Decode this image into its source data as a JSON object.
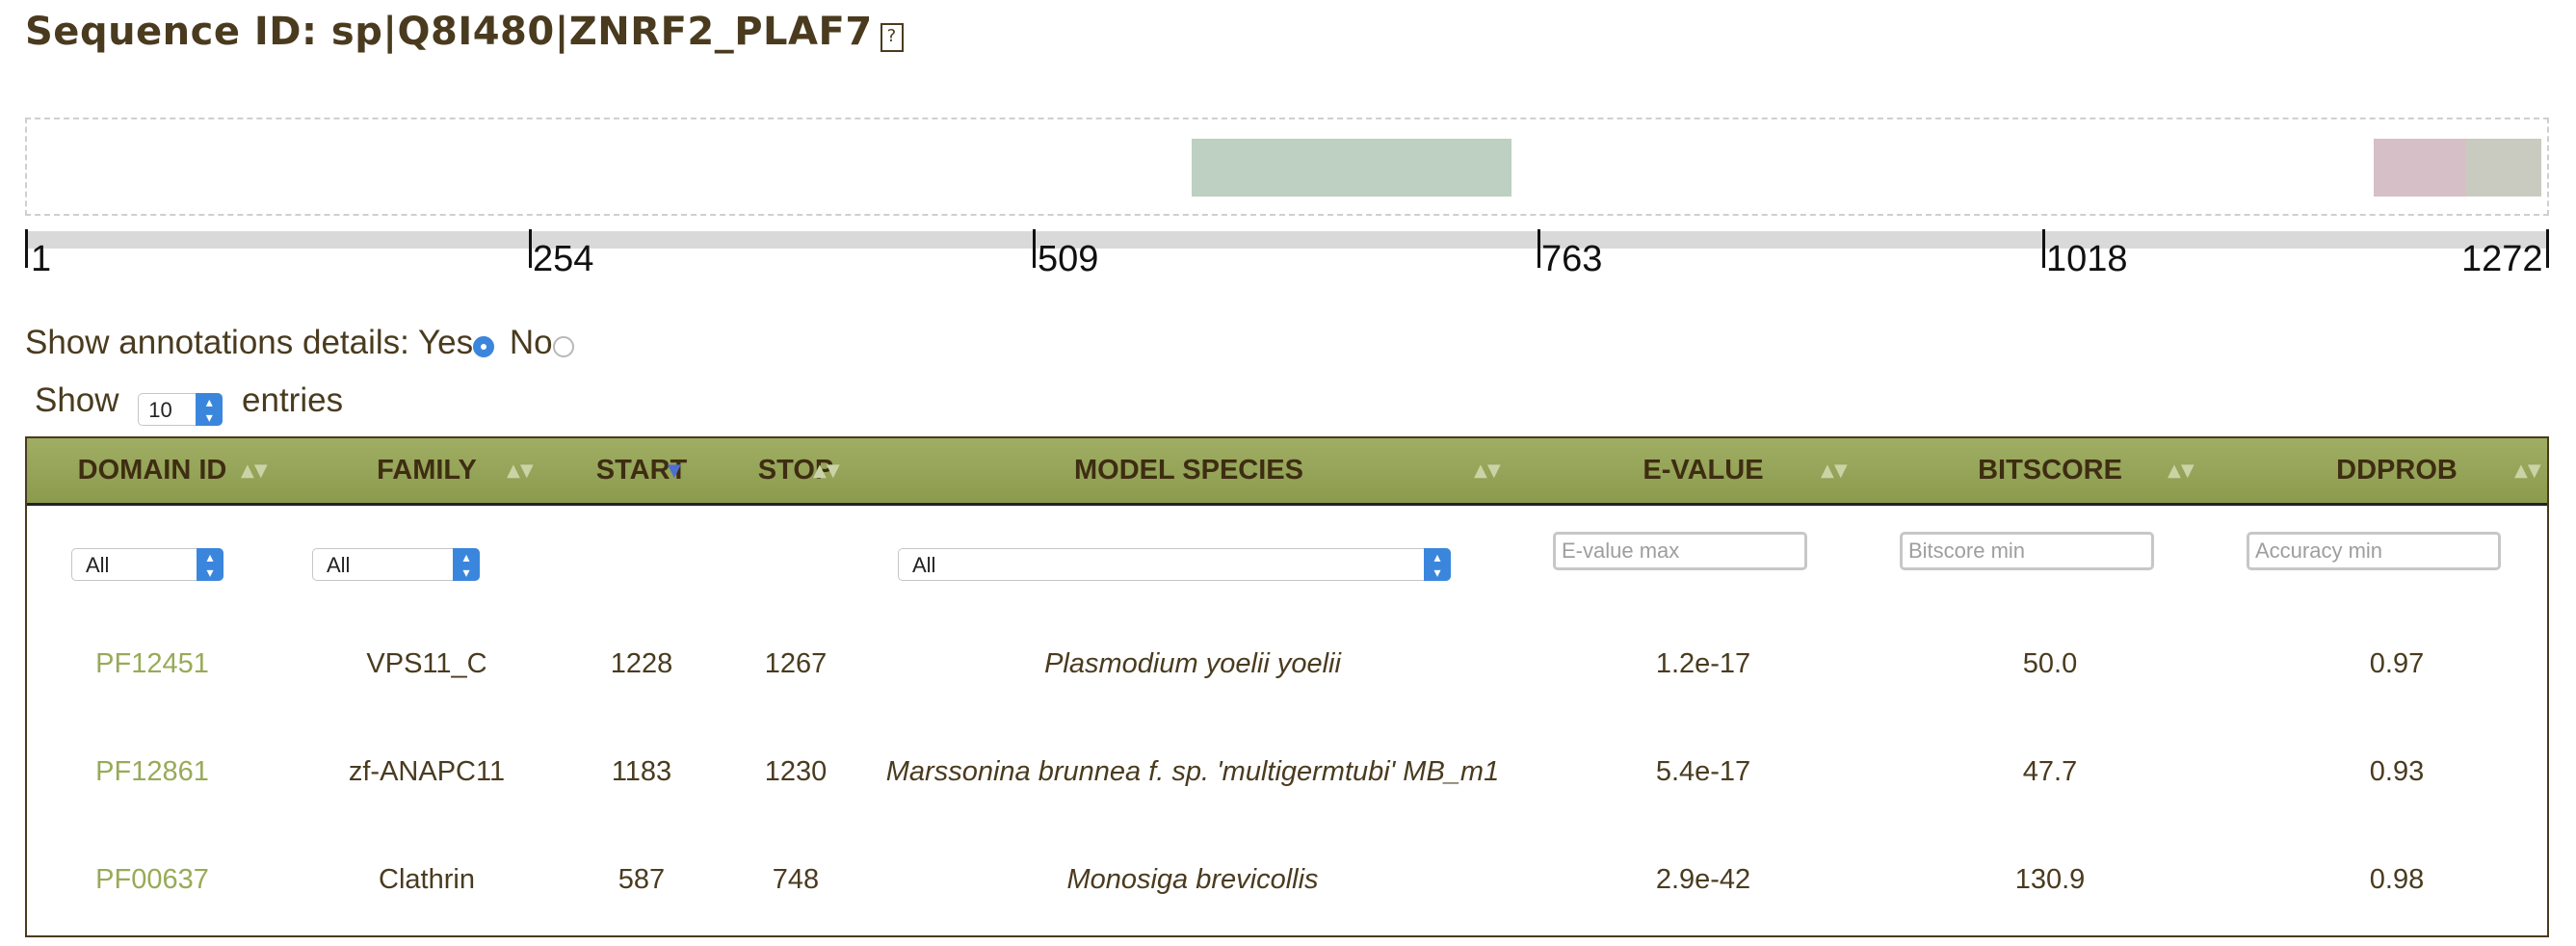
{
  "page": {
    "title": "Sequence ID: sp|Q8I480|ZNRF2_PLAF7",
    "help_icon_glyph": "?"
  },
  "domain_map": {
    "segments": [
      {
        "name": "Clathrin",
        "color": "#bdd0c2"
      },
      {
        "name": "zf-ANAPC11",
        "color": "#d6bfc6"
      },
      {
        "name": "VPS11_C",
        "color": "#c9cbc1"
      }
    ],
    "axis_ticks": [
      "1",
      "254",
      "509",
      "763",
      "1018",
      "1272"
    ]
  },
  "annotations": {
    "label": "Show annotations details:",
    "yes_label": "Yes",
    "no_label": "No",
    "selected": "Yes"
  },
  "entries": {
    "show_label": "Show",
    "value": "10",
    "entries_label": "entries"
  },
  "table": {
    "columns": [
      "DOMAIN ID",
      "FAMILY",
      "START",
      "STOP",
      "MODEL SPECIES",
      "E-VALUE",
      "BITSCORE",
      "DDPROB"
    ],
    "sorted_column": "START",
    "filters": {
      "domain_id": "All",
      "family": "All",
      "model_species": "All",
      "evalue_placeholder": "E-value max",
      "bitscore_placeholder": "Bitscore min",
      "ddprob_placeholder": "Accuracy min"
    },
    "rows": [
      {
        "domain_id": "PF12451",
        "family": "VPS11_C",
        "start": "1228",
        "stop": "1267",
        "species": "Plasmodium yoelii yoelii",
        "evalue": "1.2e-17",
        "bitscore": "50.0",
        "ddprob": "0.97"
      },
      {
        "domain_id": "PF12861",
        "family": "zf-ANAPC11",
        "start": "1183",
        "stop": "1230",
        "species": "Marssonina brunnea f. sp. 'multigermtubi' MB_m1",
        "evalue": "5.4e-17",
        "bitscore": "47.7",
        "ddprob": "0.93"
      },
      {
        "domain_id": "PF00637",
        "family": "Clathrin",
        "start": "587",
        "stop": "748",
        "species": "Monosiga brevicollis",
        "evalue": "2.9e-42",
        "bitscore": "130.9",
        "ddprob": "0.98"
      }
    ]
  }
}
